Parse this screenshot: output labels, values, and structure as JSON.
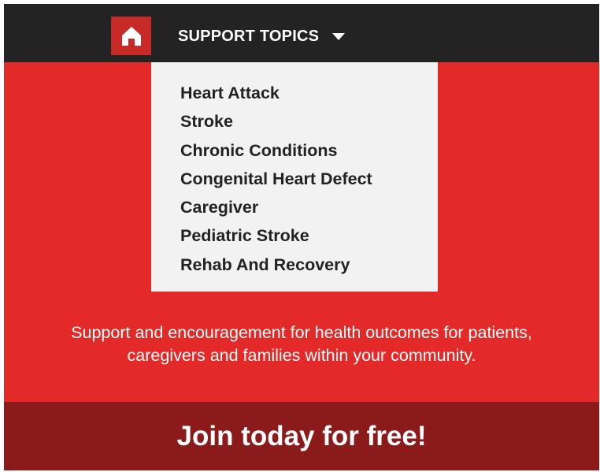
{
  "colors": {
    "primary_red": "#e42a28",
    "nav_bar": "#232323",
    "home_button": "#c72a27",
    "dropdown_bg": "#f2f2f2",
    "join_bar": "#8b1a1b"
  },
  "nav": {
    "home_icon": "home-icon",
    "topics_label": "SUPPORT TOPICS",
    "caret_icon": "caret-down-icon"
  },
  "dropdown": {
    "items": [
      "Heart Attack",
      "Stroke",
      "Chronic Conditions",
      "Congenital Heart Defect",
      "Caregiver",
      "Pediatric Stroke",
      "Rehab And Recovery"
    ]
  },
  "tagline": {
    "line1": "Support and encouragement for health outcomes for patients,",
    "line2": "caregivers and families within your community."
  },
  "cta": {
    "label": "Join today for free!"
  }
}
